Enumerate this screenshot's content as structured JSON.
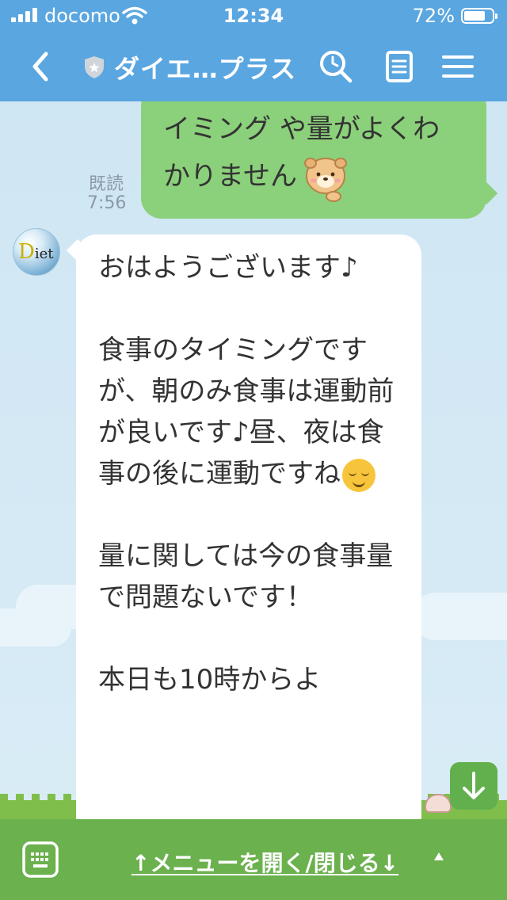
{
  "status_bar": {
    "carrier": "docomo",
    "time": "12:34",
    "battery": "72%",
    "battery_level": 0.72
  },
  "header": {
    "title": "ダイエ…プラス",
    "back_icon": "chevron-left-icon",
    "search_icon": "search-icon",
    "note_icon": "note-icon",
    "menu_icon": "hamburger-menu-icon",
    "accent_color": "#5aa6e0"
  },
  "messages": {
    "sent": {
      "line1": "イミング や量がよくわ",
      "line2": "かりません",
      "read_label": "既読",
      "time": "7:56",
      "bubble_color": "#8bd07a"
    },
    "received": {
      "avatar_text_initial": "D",
      "avatar_text_rest": "iet",
      "paragraphs": [
        "おはようございます♪",
        "食事のタイミングですが、朝のみ食事は運動前が良いです♪昼、夜は食事の後に運動ですね",
        "量に関しては今の食事量で問題ないです！",
        "本日も10時からよ"
      ]
    }
  },
  "bottom_bar": {
    "menu_toggle": "↑メニューを開く/閉じる↓",
    "keyboard_icon": "keyboard-icon",
    "bar_color": "#6bb14e"
  },
  "scroll_button_icon": "arrow-down-icon"
}
